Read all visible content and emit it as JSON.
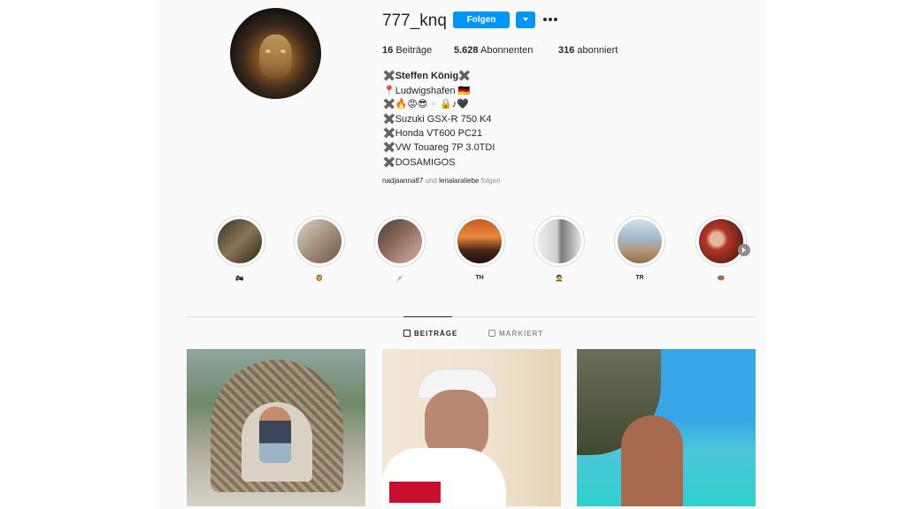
{
  "profile": {
    "username": "777_knq",
    "follow_label": "Folgen",
    "stats": {
      "posts_count": "16",
      "posts_label": "Beiträge",
      "followers_count": "5.628",
      "followers_label": "Abonnenten",
      "following_count": "316",
      "following_label": "abonniert"
    },
    "bio": {
      "name": "✖️Steffen König✖️",
      "location": "📍Ludwigshafen 🇩🇪",
      "emoji_line": "✖️🔥😡😎▫️🔒♪🖤",
      "line1": "✖️Suzuki GSX-R 750 K4",
      "line2": "✖️Honda VT600 PC21",
      "line3": "✖️VW Touareg 7P 3.0TDI",
      "line4": "✖️DOSAMIGOS"
    },
    "followed_by": {
      "user1": "nadjaanna87",
      "and": "und",
      "user2": "lenalaraliebe",
      "suffix": "folgen"
    }
  },
  "highlights": [
    {
      "label": "🏍",
      "color": "#6b5a44"
    },
    {
      "label": "🦁",
      "color": "#a08a74"
    },
    {
      "label": "💉",
      "color": "#8c6a5a"
    },
    {
      "label": "TH",
      "color": "#d9772e"
    },
    {
      "label": "🤵",
      "color": "#cfcfcf"
    },
    {
      "label": "TR",
      "color": "#9fb7c8"
    },
    {
      "label": "🍩",
      "color": "#b4362a"
    }
  ],
  "tabs": {
    "posts": "BEITRÄGE",
    "tagged": "MARKIERT"
  },
  "colors": {
    "accent": "#0095f6",
    "text": "#262626",
    "muted": "#8e8e8e",
    "border": "#dbdbdb"
  },
  "icons": {
    "more": "more-dots-icon",
    "dropdown": "chevron-down-icon",
    "posts_tab": "grid-icon",
    "tagged_tab": "tagged-user-icon",
    "highlights_next": "chevron-right-icon"
  }
}
